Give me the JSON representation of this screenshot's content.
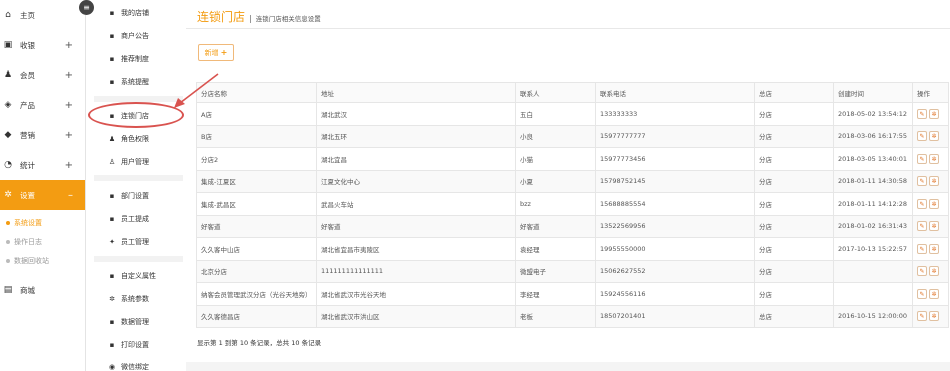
{
  "sidebar": {
    "items": [
      {
        "icon": "home-icon",
        "glyph": "⌂",
        "label": "主页",
        "plus": ""
      },
      {
        "icon": "monitor-icon",
        "glyph": "▣",
        "label": "收银",
        "plus": "+"
      },
      {
        "icon": "user-icon",
        "glyph": "♟",
        "label": "会员",
        "plus": "+"
      },
      {
        "icon": "box-icon",
        "glyph": "◈",
        "label": "产品",
        "plus": "+"
      },
      {
        "icon": "tag-icon",
        "glyph": "◆",
        "label": "营销",
        "plus": "+"
      },
      {
        "icon": "pie-chart-icon",
        "glyph": "◔",
        "label": "统计",
        "plus": "+"
      },
      {
        "icon": "gear-icon",
        "glyph": "✲",
        "label": "设置",
        "plus": "–"
      }
    ],
    "sub_items": [
      "系统设置",
      "操作日志",
      "数据回收站"
    ],
    "last_item": {
      "icon": "store-icon",
      "glyph": "▤",
      "label": "商城"
    }
  },
  "col2": {
    "items": [
      {
        "icon": "lock-icon",
        "glyph": "▪",
        "label": "我的店铺"
      },
      {
        "icon": "announcement-icon",
        "glyph": "▪",
        "label": "商户公告"
      },
      {
        "icon": "referral-icon",
        "glyph": "▪",
        "label": "推荐制度"
      },
      {
        "icon": "bell-icon",
        "glyph": "▪",
        "label": "系统提醒"
      },
      {
        "icon": "chain-store-icon",
        "glyph": "▪",
        "label": "连锁门店"
      },
      {
        "icon": "role-icon",
        "glyph": "♟",
        "label": "角色权限"
      },
      {
        "icon": "user-manage-icon",
        "glyph": "♙",
        "label": "用户管理"
      },
      {
        "icon": "department-icon",
        "glyph": "▪",
        "label": "部门设置"
      },
      {
        "icon": "commission-icon",
        "glyph": "▪",
        "label": "员工提成"
      },
      {
        "icon": "staff-icon",
        "glyph": "✦",
        "label": "员工管理"
      },
      {
        "icon": "custom-attr-icon",
        "glyph": "▪",
        "label": "自定义属性"
      },
      {
        "icon": "params-icon",
        "glyph": "✲",
        "label": "系统参数"
      },
      {
        "icon": "data-icon",
        "glyph": "▪",
        "label": "数据管理"
      },
      {
        "icon": "print-icon",
        "glyph": "▪",
        "label": "打印设置"
      },
      {
        "icon": "wechat-icon",
        "glyph": "◉",
        "label": "微信绑定"
      }
    ]
  },
  "main": {
    "title": "连锁门店",
    "title_sep": "|",
    "subtitle": "连锁门店相关信息设置",
    "add_label": "新增",
    "add_plus": "+",
    "columns": [
      "分店名称",
      "地址",
      "联系人",
      "联系电话",
      "总店",
      "创建时间",
      "操作"
    ],
    "rows": [
      [
        "A店",
        "湖北武汉",
        "五白",
        "133333333",
        "分店",
        "2018-05-02 13:54:12"
      ],
      [
        "B店",
        "湖北五环",
        "小良",
        "15977777777",
        "分店",
        "2018-03-06 16:17:55"
      ],
      [
        "分店2",
        "湖北宜昌",
        "小猫",
        "15977773456",
        "分店",
        "2018-03-05 13:40:01"
      ],
      [
        "集成-江夏区",
        "江夏文化中心",
        "小夏",
        "15798752145",
        "分店",
        "2018-01-11 14:30:58"
      ],
      [
        "集成-武昌区",
        "武昌火车站",
        "bzz",
        "15688885554",
        "分店",
        "2018-01-11 14:12:28"
      ],
      [
        "好客道",
        "好客道",
        "好客道",
        "13522569956",
        "分店",
        "2018-01-02 16:31:43"
      ],
      [
        "久久客中山店",
        "湖北省宜昌市夷陵区",
        "袁经理",
        "19955550000",
        "分店",
        "2017-10-13 15:22:57"
      ],
      [
        "北京分店",
        "111111111111111",
        "微盟电子",
        "15062627552",
        "分店",
        ""
      ],
      [
        "纳客会员管理武汉分店（光谷天地旁）",
        "湖北省武汉市光谷天地",
        "李经理",
        "15924556116",
        "分店",
        ""
      ],
      [
        "久久客德昌店",
        "湖北省武汉市洪山区",
        "老板",
        "18507201401",
        "总店",
        "2016-10-15 12:00:00"
      ]
    ],
    "edit_glyph": "✎",
    "delete_glyph": "✲",
    "footer": "显示第 1 到第 10 条记录，总共 10 条记录"
  },
  "colors": {
    "accent": "#f39c12",
    "highlight": "#d9534f"
  }
}
